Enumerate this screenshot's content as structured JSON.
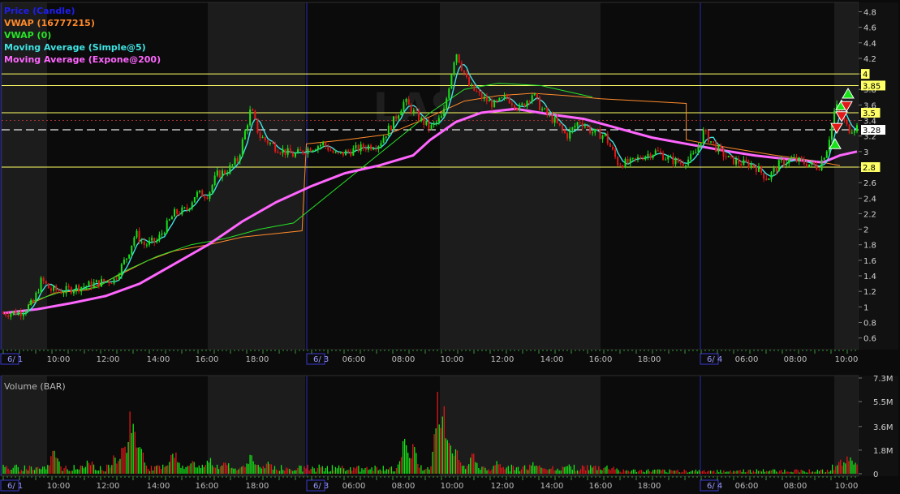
{
  "watermark": "LASE",
  "legend": [
    {
      "label": "Price (Candle)",
      "color": "#1e1ef0"
    },
    {
      "label": "VWAP (16777215)",
      "color": "#ff8a2a"
    },
    {
      "label": "VWAP (0)",
      "color": "#27e327"
    },
    {
      "label": "Moving Average (Simple@5)",
      "color": "#3fe3e3"
    },
    {
      "label": "Moving Average (Expone@200)",
      "color": "#ff66ff"
    }
  ],
  "volume_label": "Volume (BAR)",
  "colors": {
    "up": "#17e317",
    "down": "#e31717",
    "ma_simple": "#3fe3e3",
    "ma_exp": "#ff66ff",
    "vwap_a": "#ff8a2a",
    "vwap_b": "#27e327",
    "level": "#ffff66"
  },
  "chart_data": [
    {
      "type": "candlestick",
      "title": "Price (Candle)",
      "ylim": [
        0.45,
        4.92
      ],
      "price_ticks": [
        "4.8",
        "4.6",
        "4.4",
        "4.2",
        "4",
        "3.8",
        "3.6",
        "3.4",
        "3.2",
        "3",
        "2.8",
        "2.6",
        "2.4",
        "2.2",
        "2",
        "1.8",
        "1.6",
        "1.4",
        "1.2",
        "1",
        "0.8",
        "0.6"
      ],
      "price_tick_values": [
        4.8,
        4.6,
        4.4,
        4.2,
        4.0,
        3.8,
        3.6,
        3.4,
        3.2,
        3.0,
        2.8,
        2.6,
        2.4,
        2.2,
        2.0,
        1.8,
        1.6,
        1.4,
        1.2,
        1.0,
        0.8,
        0.6
      ],
      "time_labels": [
        "6/ 1",
        "10:00",
        "12:00",
        "14:00",
        "16:00",
        "18:00",
        "6/ 3",
        "06:00",
        "08:00",
        "10:00",
        "12:00",
        "14:00",
        "16:00",
        "18:00",
        "6/ 4",
        "06:00",
        "08:00",
        "10:00"
      ],
      "horizontal_levels": [
        {
          "value": 4.0,
          "label": "4",
          "style": "solid"
        },
        {
          "value": 3.85,
          "label": "3.85",
          "style": "solid"
        },
        {
          "value": 3.5,
          "label": "3.5",
          "style": "solid"
        },
        {
          "value": 3.28,
          "label": "3.28",
          "style": "dashed"
        },
        {
          "value": 2.8,
          "label": "2.8",
          "style": "solid"
        }
      ],
      "price_path": [
        [
          0,
          0.92
        ],
        [
          0.02,
          0.93
        ],
        [
          0.035,
          1.05
        ],
        [
          0.045,
          1.35
        ],
        [
          0.055,
          1.22
        ],
        [
          0.07,
          1.2
        ],
        [
          0.085,
          1.25
        ],
        [
          0.1,
          1.28
        ],
        [
          0.115,
          1.32
        ],
        [
          0.13,
          1.35
        ],
        [
          0.145,
          1.65
        ],
        [
          0.155,
          1.95
        ],
        [
          0.165,
          1.8
        ],
        [
          0.18,
          1.85
        ],
        [
          0.2,
          2.2
        ],
        [
          0.215,
          2.25
        ],
        [
          0.225,
          2.45
        ],
        [
          0.24,
          2.45
        ],
        [
          0.25,
          2.7
        ],
        [
          0.262,
          2.75
        ],
        [
          0.275,
          2.9
        ],
        [
          0.29,
          3.55
        ],
        [
          0.3,
          3.2
        ],
        [
          0.32,
          3.05
        ],
        [
          0.34,
          2.95
        ],
        [
          0.36,
          3.05
        ],
        [
          0.375,
          3.1
        ],
        [
          0.39,
          2.95
        ],
        [
          0.405,
          3.0
        ],
        [
          0.42,
          3.05
        ],
        [
          0.44,
          3.1
        ],
        [
          0.455,
          3.35
        ],
        [
          0.47,
          3.65
        ],
        [
          0.485,
          3.45
        ],
        [
          0.5,
          3.3
        ],
        [
          0.515,
          3.45
        ],
        [
          0.53,
          4.3
        ],
        [
          0.545,
          3.85
        ],
        [
          0.56,
          3.7
        ],
        [
          0.575,
          3.6
        ],
        [
          0.59,
          3.7
        ],
        [
          0.605,
          3.55
        ],
        [
          0.62,
          3.75
        ],
        [
          0.63,
          3.55
        ],
        [
          0.645,
          3.4
        ],
        [
          0.66,
          3.2
        ],
        [
          0.675,
          3.4
        ],
        [
          0.69,
          3.25
        ],
        [
          0.705,
          3.2
        ],
        [
          0.72,
          2.85
        ],
        [
          0.735,
          2.85
        ],
        [
          0.75,
          2.95
        ],
        [
          0.765,
          3.0
        ],
        [
          0.78,
          2.9
        ],
        [
          0.795,
          2.85
        ],
        [
          0.81,
          2.95
        ],
        [
          0.82,
          3.25
        ],
        [
          0.835,
          3.05
        ],
        [
          0.85,
          2.9
        ],
        [
          0.865,
          2.85
        ],
        [
          0.88,
          2.82
        ],
        [
          0.895,
          2.65
        ],
        [
          0.91,
          2.85
        ],
        [
          0.925,
          2.9
        ],
        [
          0.94,
          2.85
        ],
        [
          0.955,
          2.8
        ],
        [
          0.965,
          3.05
        ],
        [
          0.975,
          3.6
        ],
        [
          0.99,
          3.28
        ],
        [
          1.0,
          3.32
        ]
      ],
      "ma_exp_path": [
        [
          0,
          0.92
        ],
        [
          0.04,
          0.97
        ],
        [
          0.08,
          1.05
        ],
        [
          0.12,
          1.14
        ],
        [
          0.16,
          1.3
        ],
        [
          0.2,
          1.55
        ],
        [
          0.24,
          1.8
        ],
        [
          0.28,
          2.1
        ],
        [
          0.32,
          2.35
        ],
        [
          0.36,
          2.55
        ],
        [
          0.4,
          2.72
        ],
        [
          0.44,
          2.82
        ],
        [
          0.48,
          2.95
        ],
        [
          0.5,
          3.15
        ],
        [
          0.53,
          3.38
        ],
        [
          0.56,
          3.5
        ],
        [
          0.6,
          3.55
        ],
        [
          0.64,
          3.48
        ],
        [
          0.68,
          3.42
        ],
        [
          0.72,
          3.3
        ],
        [
          0.76,
          3.18
        ],
        [
          0.8,
          3.1
        ],
        [
          0.84,
          3.02
        ],
        [
          0.88,
          2.95
        ],
        [
          0.92,
          2.9
        ],
        [
          0.96,
          2.86
        ],
        [
          0.98,
          2.95
        ],
        [
          1.0,
          3.0
        ]
      ],
      "vwap_a_path": [
        [
          0.03,
          1.03
        ],
        [
          0.06,
          1.18
        ],
        [
          0.1,
          1.22
        ],
        [
          0.13,
          1.38
        ],
        [
          0.17,
          1.6
        ],
        [
          0.2,
          1.72
        ],
        [
          0.24,
          1.8
        ],
        [
          0.28,
          1.9
        ],
        [
          0.35,
          1.98
        ],
        [
          0.355,
          3.1
        ],
        [
          0.4,
          3.15
        ],
        [
          0.45,
          3.22
        ],
        [
          0.5,
          3.45
        ],
        [
          0.54,
          3.65
        ],
        [
          0.58,
          3.72
        ],
        [
          0.62,
          3.75
        ],
        [
          0.66,
          3.72
        ],
        [
          0.7,
          3.68
        ],
        [
          0.8,
          3.62
        ],
        [
          0.8,
          3.15
        ],
        [
          0.85,
          3.05
        ],
        [
          0.9,
          2.96
        ],
        [
          0.95,
          2.88
        ],
        [
          0.98,
          2.82
        ]
      ],
      "vwap_b_path": [
        [
          0.03,
          1.06
        ],
        [
          0.07,
          1.2
        ],
        [
          0.11,
          1.25
        ],
        [
          0.14,
          1.45
        ],
        [
          0.18,
          1.65
        ],
        [
          0.22,
          1.8
        ],
        [
          0.26,
          1.88
        ],
        [
          0.3,
          2.0
        ],
        [
          0.34,
          2.08
        ],
        [
          0.5,
          3.5
        ],
        [
          0.54,
          3.8
        ],
        [
          0.58,
          3.88
        ],
        [
          0.63,
          3.85
        ],
        [
          0.69,
          3.7
        ]
      ],
      "signals": [
        {
          "type": "buy",
          "value": 3.1
        },
        {
          "type": "sell",
          "value": 3.3
        },
        {
          "type": "sell",
          "value": 3.45
        },
        {
          "type": "buy",
          "value": 3.6
        },
        {
          "type": "sell",
          "value": 3.58
        },
        {
          "type": "buy",
          "value": 3.75
        }
      ]
    },
    {
      "type": "bar",
      "title": "Volume (BAR)",
      "ylim": [
        0,
        7.3
      ],
      "unit": "M",
      "volume_ticks": [
        "7.3M",
        "5.5M",
        "3.6M",
        "1.8M",
        "0"
      ],
      "volume_tick_values": [
        7.3,
        5.5,
        3.6,
        1.8,
        0
      ],
      "volume_spikes": [
        [
          0.06,
          2.4
        ],
        [
          0.1,
          1.6
        ],
        [
          0.13,
          1.6
        ],
        [
          0.14,
          2.9
        ],
        [
          0.15,
          6.2
        ],
        [
          0.16,
          3.0
        ],
        [
          0.2,
          2.2
        ],
        [
          0.22,
          1.5
        ],
        [
          0.24,
          1.8
        ],
        [
          0.26,
          1.6
        ],
        [
          0.29,
          2.0
        ],
        [
          0.31,
          1.2
        ],
        [
          0.47,
          3.2
        ],
        [
          0.48,
          2.5
        ],
        [
          0.51,
          7.3
        ],
        [
          0.515,
          6.6
        ],
        [
          0.52,
          4.8
        ],
        [
          0.53,
          2.2
        ],
        [
          0.55,
          1.8
        ],
        [
          0.58,
          1.3
        ],
        [
          0.62,
          1.1
        ],
        [
          0.66,
          1.0
        ],
        [
          0.98,
          1.2
        ],
        [
          0.99,
          2.0
        ],
        [
          1.0,
          1.4
        ]
      ]
    }
  ]
}
